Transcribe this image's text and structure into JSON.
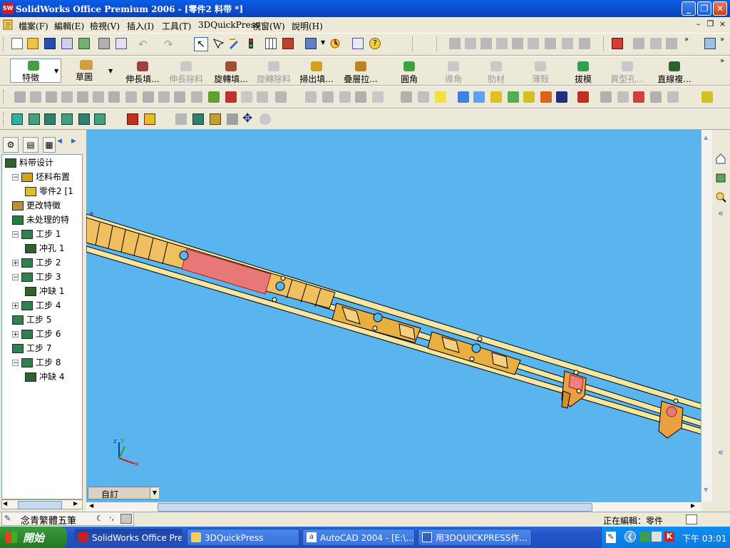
{
  "window": {
    "title": "SolidWorks Office Premium 2006 - [零件2 料带 *]",
    "app_icon": "SW",
    "controls": {
      "minimize": "_",
      "restore": "❐",
      "close": "✕"
    }
  },
  "menu": {
    "items": [
      "檔案(F)",
      "編輯(E)",
      "檢視(V)",
      "插入(I)",
      "工具(T)",
      "3DQuickPress",
      "視窗(W)",
      "說明(H)"
    ],
    "mdi": {
      "minimize": "–",
      "restore": "❐",
      "close": "×"
    }
  },
  "feature_toolbar": {
    "items": [
      {
        "label": "特徵",
        "enabled": true
      },
      {
        "label": "草圖",
        "enabled": true
      },
      {
        "label": "伸長填...",
        "enabled": true
      },
      {
        "label": "伸長除料",
        "enabled": false
      },
      {
        "label": "旋轉填...",
        "enabled": true
      },
      {
        "label": "旋轉除料",
        "enabled": false
      },
      {
        "label": "掃出填...",
        "enabled": true
      },
      {
        "label": "疊層拉...",
        "enabled": true
      },
      {
        "label": "圓角",
        "enabled": true
      },
      {
        "label": "導角",
        "enabled": false
      },
      {
        "label": "肋材",
        "enabled": false
      },
      {
        "label": "薄殼",
        "enabled": false
      },
      {
        "label": "拔模",
        "enabled": true
      },
      {
        "label": "異型孔...",
        "enabled": false
      },
      {
        "label": "直線複...",
        "enabled": true
      }
    ]
  },
  "tree": {
    "items": [
      {
        "label": "料带设计",
        "indent": 0,
        "expander": "",
        "icon": "strip-design-icon"
      },
      {
        "label": "坯料布置",
        "indent": 1,
        "expander": "-",
        "icon": "blank-layout-icon"
      },
      {
        "label": "零件2 [1",
        "indent": 2,
        "expander": "",
        "icon": "part-icon"
      },
      {
        "label": "更改特徵",
        "indent": 1,
        "expander": "",
        "icon": "change-feature-icon"
      },
      {
        "label": "未处理的特",
        "indent": 1,
        "expander": "",
        "icon": "unprocessed-feature-icon"
      },
      {
        "label": "工步 1",
        "indent": 1,
        "expander": "-",
        "icon": "station-icon"
      },
      {
        "label": "冲孔 1",
        "indent": 2,
        "expander": "",
        "icon": "pierce-icon"
      },
      {
        "label": "工步 2",
        "indent": 1,
        "expander": "+",
        "icon": "station-icon"
      },
      {
        "label": "工步 3",
        "indent": 1,
        "expander": "-",
        "icon": "station-icon"
      },
      {
        "label": "冲缺 1",
        "indent": 2,
        "expander": "",
        "icon": "notch-icon"
      },
      {
        "label": "工步 4",
        "indent": 1,
        "expander": "+",
        "icon": "station-icon"
      },
      {
        "label": "工步 5",
        "indent": 1,
        "expander": "",
        "icon": "station-icon"
      },
      {
        "label": "工步 6",
        "indent": 1,
        "expander": "+",
        "icon": "station-icon"
      },
      {
        "label": "工步 7",
        "indent": 1,
        "expander": "",
        "icon": "station-icon"
      },
      {
        "label": "工步 8",
        "indent": 1,
        "expander": "-",
        "icon": "station-icon"
      },
      {
        "label": "冲缺 4",
        "indent": 2,
        "expander": "",
        "icon": "notch-icon"
      }
    ]
  },
  "viewport": {
    "background": "#5ab4ee",
    "view_selector": "自訂",
    "triad": {
      "x": "x",
      "y": "y",
      "z": "z"
    }
  },
  "status": {
    "ime_label": "念青繁體五筆",
    "editing": "正在編輯：零件"
  },
  "taskbar": {
    "start": "開始",
    "tasks": [
      {
        "label": "SolidWorks Office Pre...",
        "active": true
      },
      {
        "label": "3DQuickPress",
        "active": false
      },
      {
        "label": "AutoCAD 2004 - [E:\\...",
        "active": false
      },
      {
        "label": "用3DQUICKPRESS作...",
        "active": false
      }
    ],
    "clock": "下午 03:01"
  }
}
